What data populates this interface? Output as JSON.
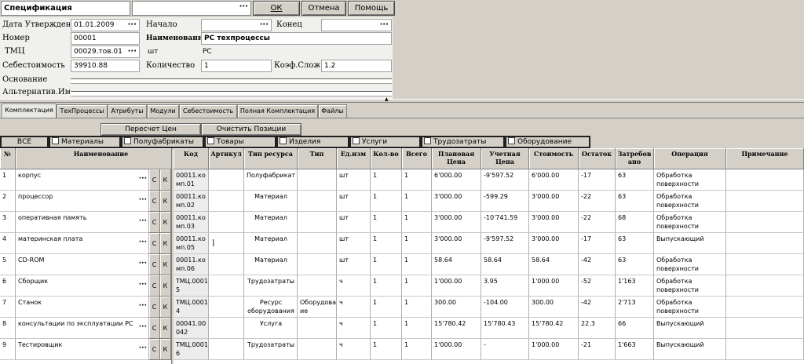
{
  "window": {
    "title": "Спецификация",
    "select_value": ""
  },
  "buttons": {
    "ok": "ОК",
    "cancel": "Отмена",
    "help": "Помощь"
  },
  "form": {
    "date_label": "Дата Утверждения",
    "date_value": "01.01.2009",
    "start_label": "Начало",
    "start_value": "",
    "end_label": "Конец",
    "end_value": "",
    "number_label": "Номер",
    "number_value": "00001",
    "name_label": "Наименование",
    "name_value": "PC техпроцессы",
    "tmc_label": "ТМЦ",
    "tmc_value": "00029.тов.01",
    "tmc_unit": "шт",
    "tmc_name": "PC",
    "cost_label": "Себестоимость",
    "cost_value": "39910.88",
    "qty_label": "Количество",
    "qty_value": "1",
    "coef_label": "Коэф.Сложн",
    "coef_value": "1.2",
    "basis_label": "Основание",
    "altname_label": "Альтернатив.Имя"
  },
  "tabs": [
    "Комплектация",
    "ТехПроцессы",
    "Атрибуты",
    "Модули",
    "Себестоимость",
    "Полная Комплектация",
    "Файлы"
  ],
  "active_tab": 0,
  "actions": {
    "recalc": "Пересчет Цен",
    "clear": "Очистить Позиции"
  },
  "filters": [
    "ВСЕ",
    "Материалы",
    "Полуфабрикаты",
    "Товары",
    "Изделия",
    "Услуги",
    "Трудозатраты",
    "Оборудование"
  ],
  "columns": [
    "№",
    "Наименование",
    "Код",
    "Артикул",
    "Тип ресурса",
    "Тип",
    "Ед.изм",
    "Кол-во",
    "Всего",
    "Плановая Цена",
    "Учетная Цена",
    "Стоимость",
    "Остаток",
    "Затребов ано",
    "Операция",
    "Примечание"
  ],
  "row_buttons": {
    "c": "С",
    "k": "К"
  },
  "rows": [
    {
      "n": "1",
      "name": "корпус",
      "code": "00011.ко мп.01",
      "article": "",
      "res_type": "Полуфабрикат",
      "type": "",
      "unit": "шт",
      "qty": "1",
      "total": "1",
      "plan_price": "6'000.00",
      "acc_price": "-9'597.52",
      "cost": "6'000.00",
      "stock": "-17",
      "requested": "63",
      "operation": "Обработка поверхности",
      "note": ""
    },
    {
      "n": "2",
      "name": "процессор",
      "code": "00011.ко мп.02",
      "article": "",
      "res_type": "Материал",
      "type": "",
      "unit": "шт",
      "qty": "1",
      "total": "1",
      "plan_price": "3'000.00",
      "acc_price": "-599.29",
      "cost": "3'000.00",
      "stock": "-22",
      "requested": "63",
      "operation": "Обработка поверхности",
      "note": ""
    },
    {
      "n": "3",
      "name": "оперативная память",
      "code": "00011.ко мп.03",
      "article": "",
      "res_type": "Материал",
      "type": "",
      "unit": "шт",
      "qty": "1",
      "total": "1",
      "plan_price": "3'000.00",
      "acc_price": "-10'741.59",
      "cost": "3'000.00",
      "stock": "-22",
      "requested": "68",
      "operation": "Обработка поверхности",
      "note": ""
    },
    {
      "n": "4",
      "name": "материнская плата",
      "code": "00011.ко мп.05",
      "article": "",
      "res_type": "Материал",
      "type": "",
      "unit": "шт",
      "qty": "1",
      "total": "1",
      "plan_price": "3'000.00",
      "acc_price": "-9'597.52",
      "cost": "3'000.00",
      "stock": "-17",
      "requested": "63",
      "operation": "Выпускающий",
      "note": ""
    },
    {
      "n": "5",
      "name": "CD-ROM",
      "code": "00011.ко мп.06",
      "article": "",
      "res_type": "Материал",
      "type": "",
      "unit": "шт",
      "qty": "1",
      "total": "1",
      "plan_price": "58.64",
      "acc_price": "58.64",
      "cost": "58.64",
      "stock": "-42",
      "requested": "63",
      "operation": "Обработка поверхности",
      "note": ""
    },
    {
      "n": "6",
      "name": "Сборщик",
      "code": "ТМЦ.0001 5",
      "article": "",
      "res_type": "Трудозатраты",
      "type": "",
      "unit": "ч",
      "qty": "1",
      "total": "1",
      "plan_price": "1'000.00",
      "acc_price": "3.95",
      "cost": "1'000.00",
      "stock": "-52",
      "requested": "1'163",
      "operation": "Обработка поверхности",
      "note": ""
    },
    {
      "n": "7",
      "name": "Станок",
      "code": "ТМЦ.0001 4",
      "article": "",
      "res_type": "Ресурс оборудования",
      "type": "Оборудован ие",
      "unit": "ч",
      "qty": "1",
      "total": "1",
      "plan_price": "300.00",
      "acc_price": "-104.00",
      "cost": "300.00",
      "stock": "-42",
      "requested": "2'713",
      "operation": "Обработка поверхности",
      "note": ""
    },
    {
      "n": "8",
      "name": "консультации по эксплуатации PC",
      "code": "00041.00 042",
      "article": "",
      "res_type": "Услуга",
      "type": "",
      "unit": "ч",
      "qty": "1",
      "total": "1",
      "plan_price": "15'780.42",
      "acc_price": "15'780.43",
      "cost": "15'780.42",
      "stock": "22.3",
      "requested": "66",
      "operation": "Выпускающий",
      "note": ""
    },
    {
      "n": "9",
      "name": "Тестировщик",
      "code": "ТМЦ.0001 6",
      "article": "",
      "res_type": "Трудозатраты",
      "type": "",
      "unit": "ч",
      "qty": "1",
      "total": "1",
      "plan_price": "1'000.00",
      "acc_price": "-",
      "cost": "1'000.00",
      "stock": "-21",
      "requested": "1'663",
      "operation": "Выпускающий",
      "note": ""
    }
  ]
}
